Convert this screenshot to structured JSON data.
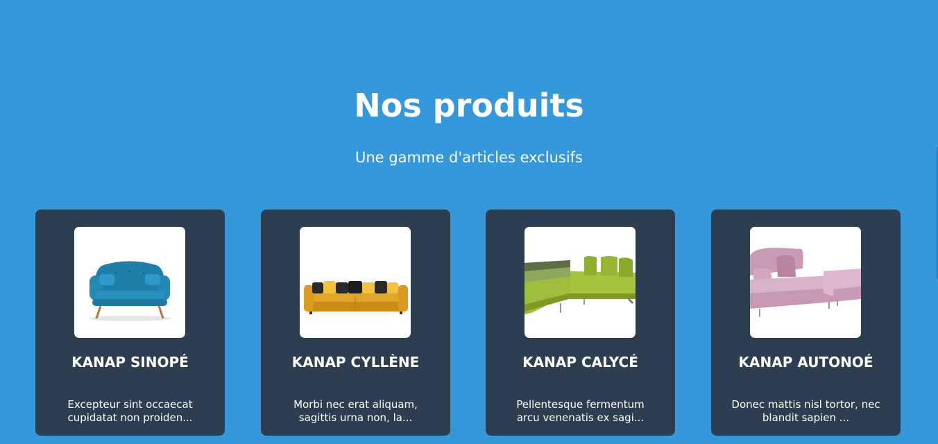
{
  "section": {
    "title": "Nos produits",
    "subtitle": "Une gamme d'articles exclusifs"
  },
  "products": [
    {
      "name": "KANAP SINOPÉ",
      "description_line1": "Excepteur sint occaecat",
      "description_line2": "cupidatat non proiden...",
      "image_icon": "blue-sofa-image"
    },
    {
      "name": "KANAP CYLLÈNE",
      "description_line1": "Morbi nec erat aliquam,",
      "description_line2": "sagittis urna non, la...",
      "image_icon": "yellow-sofa-image"
    },
    {
      "name": "KANAP CALYCÉ",
      "description_line1": "Pellentesque fermentum",
      "description_line2": "arcu venenatis ex sagi...",
      "image_icon": "green-corner-sofa-image"
    },
    {
      "name": "KANAP AUTONOÉ",
      "description_line1": "Donec mattis nisl tortor, nec",
      "description_line2": "blandit sapien ...",
      "image_icon": "pink-sofa-image"
    }
  ],
  "colors": {
    "background": "#3498db",
    "card": "#2c3e50",
    "text": "#ffffff"
  }
}
